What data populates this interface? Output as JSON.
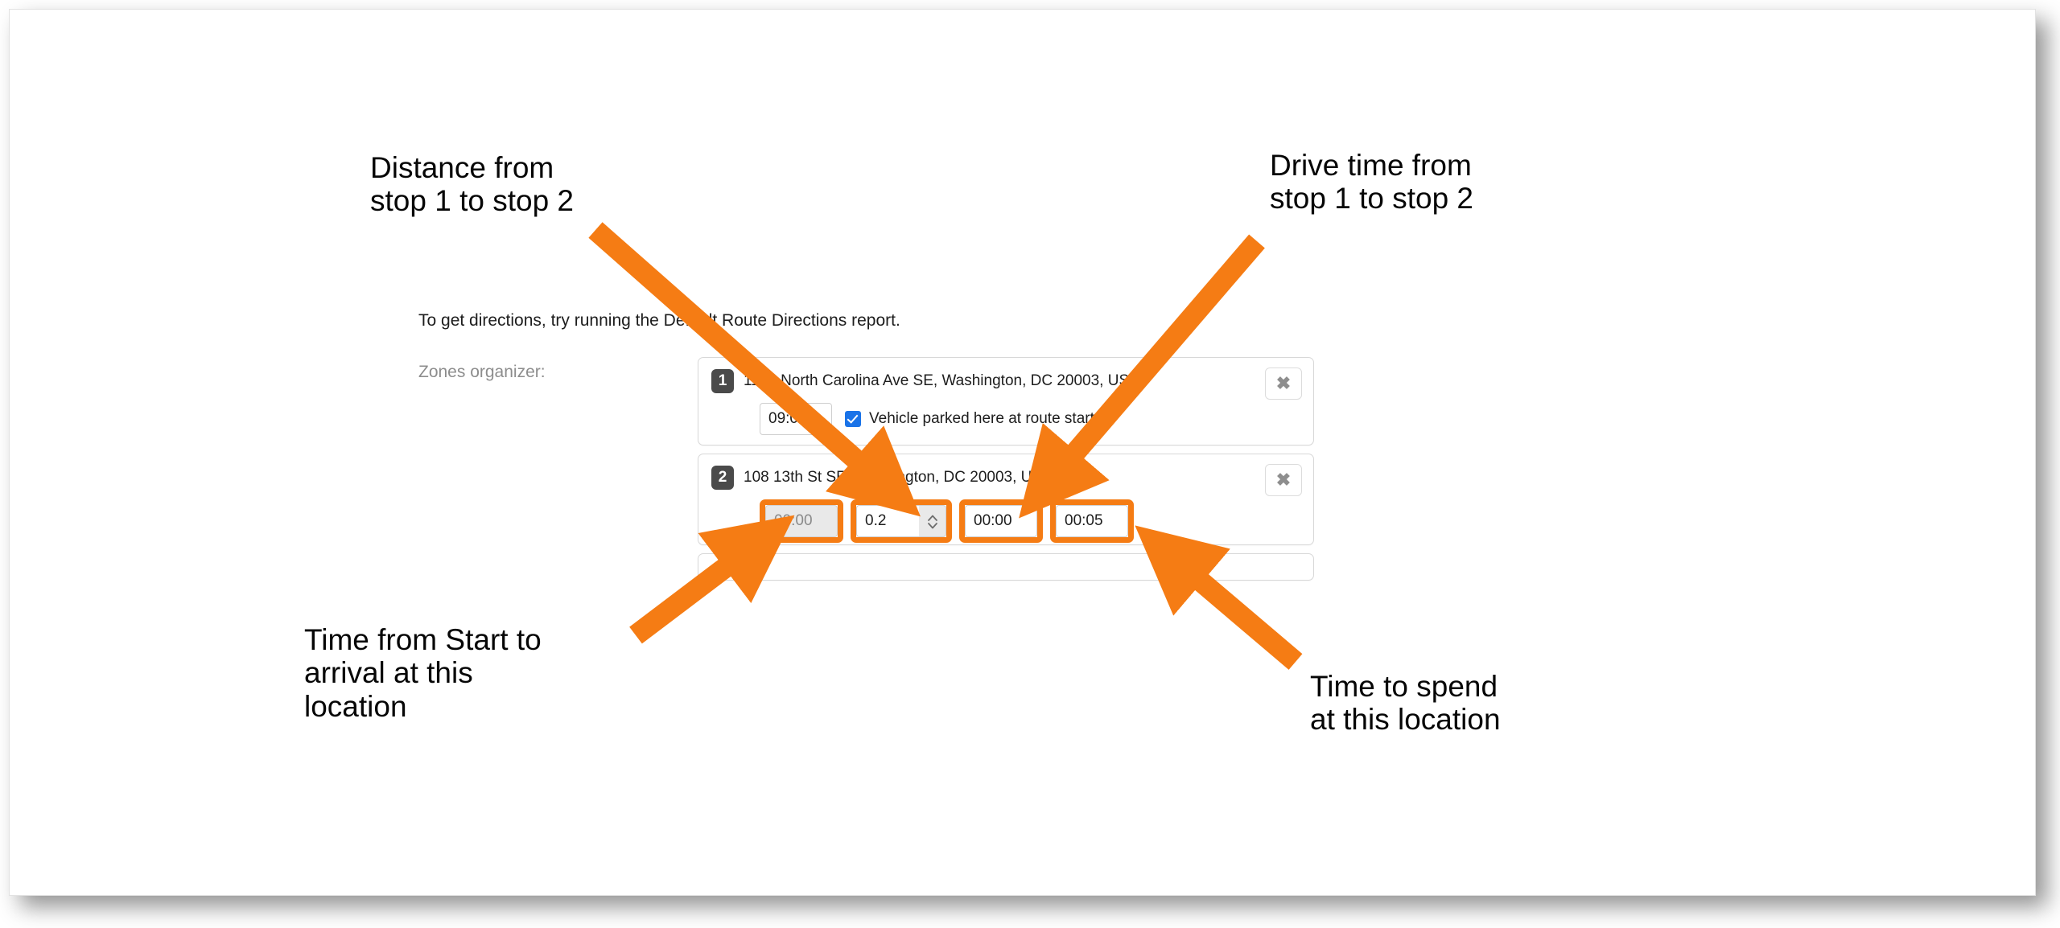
{
  "accent_color": "#F57C14",
  "app": {
    "intro_text": "To get directions, try running the Default Route Directions report.",
    "zones_label": "Zones organizer:"
  },
  "stops": [
    {
      "number": "1",
      "address": "1120 North Carolina Ave SE, Washington, DC 20003, USA",
      "arrival_time": "09:00",
      "checkbox_label": "Vehicle parked here at route start.",
      "checkbox_checked": true,
      "close_label": "✖"
    },
    {
      "number": "2",
      "address": "108 13th St SE, Washington, DC 20003, USA",
      "arrival_time": "09:00",
      "distance": "0.2",
      "drive_time": "00:00",
      "service_time": "00:05",
      "close_label": "✖"
    }
  ],
  "annotations": {
    "distance": "Distance from\nstop 1 to stop 2",
    "drive_time": "Drive time from\nstop 1 to stop 2",
    "start_time": "Time from Start to\narrival at this\nlocation",
    "spend_time": "Time to spend\nat this location"
  }
}
